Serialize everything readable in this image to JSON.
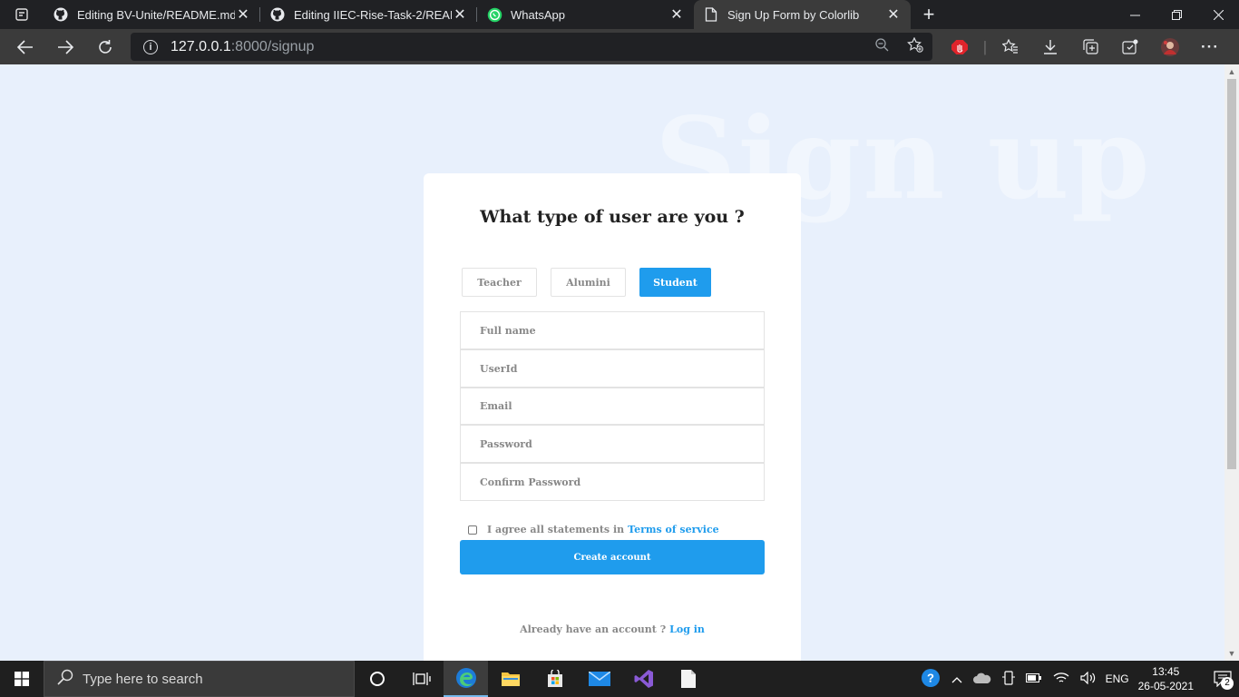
{
  "browser": {
    "tabs": [
      {
        "title": "Editing BV-Unite/README.md at",
        "icon": "github-icon"
      },
      {
        "title": "Editing IIEC-Rise-Task-2/READMI",
        "icon": "github-icon"
      },
      {
        "title": "WhatsApp",
        "icon": "whatsapp-icon"
      },
      {
        "title": "Sign Up Form by Colorlib",
        "icon": "page-icon"
      }
    ],
    "url_host": "127.0.0.1",
    "url_path": ":8000/signup"
  },
  "page": {
    "background_title": "Sign up",
    "heading": "What type of user are you ?",
    "roles": [
      "Teacher",
      "Alumini",
      "Student"
    ],
    "selected_role": "Student",
    "fields": {
      "full_name": "Full name",
      "user_id": "UserId",
      "email": "Email",
      "password": "Password",
      "confirm_password": "Confirm Password"
    },
    "agree_text": "I agree all statements in",
    "terms_link": "Terms of service",
    "create_button": "Create account",
    "login_prompt": "Already have an account ?",
    "login_link": "Log in"
  },
  "taskbar": {
    "search_placeholder": "Type here to search",
    "language": "ENG",
    "time": "13:45",
    "date": "26-05-2021",
    "notification_count": "2"
  },
  "colors": {
    "accent": "#1f9ced",
    "page_bg": "#e8f0fc"
  }
}
